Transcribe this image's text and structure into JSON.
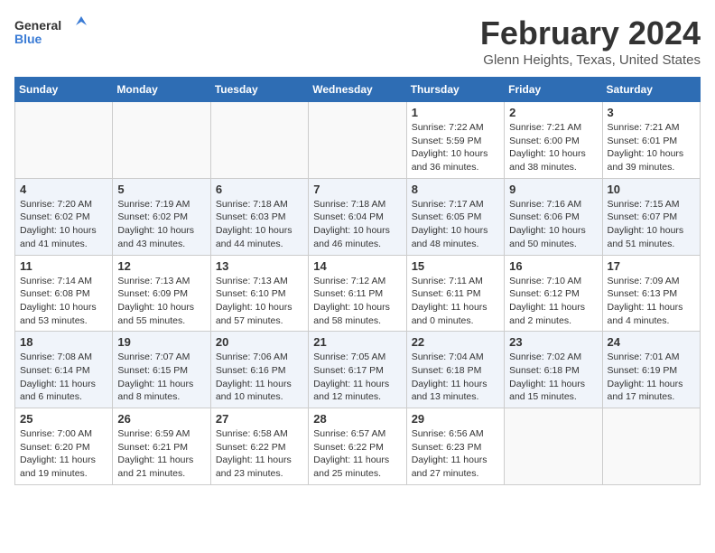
{
  "logo": {
    "general": "General",
    "blue": "Blue"
  },
  "title": "February 2024",
  "location": "Glenn Heights, Texas, United States",
  "days_of_week": [
    "Sunday",
    "Monday",
    "Tuesday",
    "Wednesday",
    "Thursday",
    "Friday",
    "Saturday"
  ],
  "weeks": [
    {
      "row_index": 0,
      "days": [
        {
          "date": "",
          "sunrise": "",
          "sunset": "",
          "daylight": ""
        },
        {
          "date": "",
          "sunrise": "",
          "sunset": "",
          "daylight": ""
        },
        {
          "date": "",
          "sunrise": "",
          "sunset": "",
          "daylight": ""
        },
        {
          "date": "",
          "sunrise": "",
          "sunset": "",
          "daylight": ""
        },
        {
          "date": "1",
          "sunrise": "Sunrise: 7:22 AM",
          "sunset": "Sunset: 5:59 PM",
          "daylight": "Daylight: 10 hours and 36 minutes."
        },
        {
          "date": "2",
          "sunrise": "Sunrise: 7:21 AM",
          "sunset": "Sunset: 6:00 PM",
          "daylight": "Daylight: 10 hours and 38 minutes."
        },
        {
          "date": "3",
          "sunrise": "Sunrise: 7:21 AM",
          "sunset": "Sunset: 6:01 PM",
          "daylight": "Daylight: 10 hours and 39 minutes."
        }
      ]
    },
    {
      "row_index": 1,
      "days": [
        {
          "date": "4",
          "sunrise": "Sunrise: 7:20 AM",
          "sunset": "Sunset: 6:02 PM",
          "daylight": "Daylight: 10 hours and 41 minutes."
        },
        {
          "date": "5",
          "sunrise": "Sunrise: 7:19 AM",
          "sunset": "Sunset: 6:02 PM",
          "daylight": "Daylight: 10 hours and 43 minutes."
        },
        {
          "date": "6",
          "sunrise": "Sunrise: 7:18 AM",
          "sunset": "Sunset: 6:03 PM",
          "daylight": "Daylight: 10 hours and 44 minutes."
        },
        {
          "date": "7",
          "sunrise": "Sunrise: 7:18 AM",
          "sunset": "Sunset: 6:04 PM",
          "daylight": "Daylight: 10 hours and 46 minutes."
        },
        {
          "date": "8",
          "sunrise": "Sunrise: 7:17 AM",
          "sunset": "Sunset: 6:05 PM",
          "daylight": "Daylight: 10 hours and 48 minutes."
        },
        {
          "date": "9",
          "sunrise": "Sunrise: 7:16 AM",
          "sunset": "Sunset: 6:06 PM",
          "daylight": "Daylight: 10 hours and 50 minutes."
        },
        {
          "date": "10",
          "sunrise": "Sunrise: 7:15 AM",
          "sunset": "Sunset: 6:07 PM",
          "daylight": "Daylight: 10 hours and 51 minutes."
        }
      ]
    },
    {
      "row_index": 2,
      "days": [
        {
          "date": "11",
          "sunrise": "Sunrise: 7:14 AM",
          "sunset": "Sunset: 6:08 PM",
          "daylight": "Daylight: 10 hours and 53 minutes."
        },
        {
          "date": "12",
          "sunrise": "Sunrise: 7:13 AM",
          "sunset": "Sunset: 6:09 PM",
          "daylight": "Daylight: 10 hours and 55 minutes."
        },
        {
          "date": "13",
          "sunrise": "Sunrise: 7:13 AM",
          "sunset": "Sunset: 6:10 PM",
          "daylight": "Daylight: 10 hours and 57 minutes."
        },
        {
          "date": "14",
          "sunrise": "Sunrise: 7:12 AM",
          "sunset": "Sunset: 6:11 PM",
          "daylight": "Daylight: 10 hours and 58 minutes."
        },
        {
          "date": "15",
          "sunrise": "Sunrise: 7:11 AM",
          "sunset": "Sunset: 6:11 PM",
          "daylight": "Daylight: 11 hours and 0 minutes."
        },
        {
          "date": "16",
          "sunrise": "Sunrise: 7:10 AM",
          "sunset": "Sunset: 6:12 PM",
          "daylight": "Daylight: 11 hours and 2 minutes."
        },
        {
          "date": "17",
          "sunrise": "Sunrise: 7:09 AM",
          "sunset": "Sunset: 6:13 PM",
          "daylight": "Daylight: 11 hours and 4 minutes."
        }
      ]
    },
    {
      "row_index": 3,
      "days": [
        {
          "date": "18",
          "sunrise": "Sunrise: 7:08 AM",
          "sunset": "Sunset: 6:14 PM",
          "daylight": "Daylight: 11 hours and 6 minutes."
        },
        {
          "date": "19",
          "sunrise": "Sunrise: 7:07 AM",
          "sunset": "Sunset: 6:15 PM",
          "daylight": "Daylight: 11 hours and 8 minutes."
        },
        {
          "date": "20",
          "sunrise": "Sunrise: 7:06 AM",
          "sunset": "Sunset: 6:16 PM",
          "daylight": "Daylight: 11 hours and 10 minutes."
        },
        {
          "date": "21",
          "sunrise": "Sunrise: 7:05 AM",
          "sunset": "Sunset: 6:17 PM",
          "daylight": "Daylight: 11 hours and 12 minutes."
        },
        {
          "date": "22",
          "sunrise": "Sunrise: 7:04 AM",
          "sunset": "Sunset: 6:18 PM",
          "daylight": "Daylight: 11 hours and 13 minutes."
        },
        {
          "date": "23",
          "sunrise": "Sunrise: 7:02 AM",
          "sunset": "Sunset: 6:18 PM",
          "daylight": "Daylight: 11 hours and 15 minutes."
        },
        {
          "date": "24",
          "sunrise": "Sunrise: 7:01 AM",
          "sunset": "Sunset: 6:19 PM",
          "daylight": "Daylight: 11 hours and 17 minutes."
        }
      ]
    },
    {
      "row_index": 4,
      "days": [
        {
          "date": "25",
          "sunrise": "Sunrise: 7:00 AM",
          "sunset": "Sunset: 6:20 PM",
          "daylight": "Daylight: 11 hours and 19 minutes."
        },
        {
          "date": "26",
          "sunrise": "Sunrise: 6:59 AM",
          "sunset": "Sunset: 6:21 PM",
          "daylight": "Daylight: 11 hours and 21 minutes."
        },
        {
          "date": "27",
          "sunrise": "Sunrise: 6:58 AM",
          "sunset": "Sunset: 6:22 PM",
          "daylight": "Daylight: 11 hours and 23 minutes."
        },
        {
          "date": "28",
          "sunrise": "Sunrise: 6:57 AM",
          "sunset": "Sunset: 6:22 PM",
          "daylight": "Daylight: 11 hours and 25 minutes."
        },
        {
          "date": "29",
          "sunrise": "Sunrise: 6:56 AM",
          "sunset": "Sunset: 6:23 PM",
          "daylight": "Daylight: 11 hours and 27 minutes."
        },
        {
          "date": "",
          "sunrise": "",
          "sunset": "",
          "daylight": ""
        },
        {
          "date": "",
          "sunrise": "",
          "sunset": "",
          "daylight": ""
        }
      ]
    }
  ]
}
